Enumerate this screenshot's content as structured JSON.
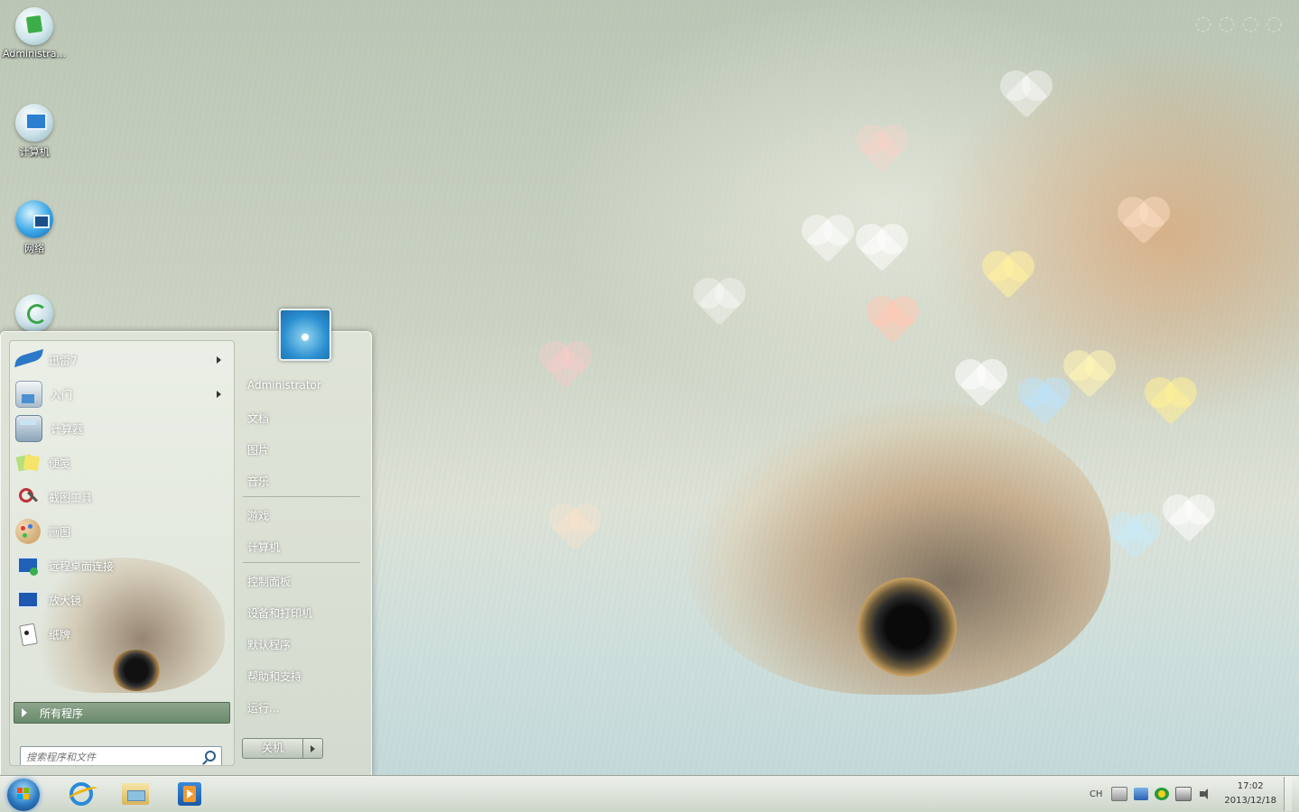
{
  "desktop": {
    "icons": [
      {
        "label": "Administra...",
        "icon": "user-folder-icon"
      },
      {
        "label": "计算机",
        "icon": "computer-icon"
      },
      {
        "label": "网络",
        "icon": "network-icon"
      },
      {
        "label": "",
        "icon": "recycle-bin-icon"
      }
    ]
  },
  "start_menu": {
    "programs": [
      {
        "label": "迅雷7",
        "icon": "xunlei-bird-icon",
        "has_submenu": true
      },
      {
        "label": "入门",
        "icon": "getting-started-icon",
        "has_submenu": true
      },
      {
        "label": "计算器",
        "icon": "calculator-icon",
        "has_submenu": false
      },
      {
        "label": "便笺",
        "icon": "sticky-notes-icon",
        "has_submenu": false
      },
      {
        "label": "截图工具",
        "icon": "snipping-tool-icon",
        "has_submenu": false
      },
      {
        "label": "画图",
        "icon": "paint-palette-icon",
        "has_submenu": false
      },
      {
        "label": "远程桌面连接",
        "icon": "remote-desktop-icon",
        "has_submenu": false
      },
      {
        "label": "放大镜",
        "icon": "magnifier-icon",
        "has_submenu": false
      },
      {
        "label": "纸牌",
        "icon": "solitaire-cards-icon",
        "has_submenu": false
      }
    ],
    "all_programs_label": "所有程序",
    "search_placeholder": "搜索程序和文件",
    "right_items": {
      "user": "Administrator",
      "documents": "文档",
      "pictures": "图片",
      "music": "音乐",
      "games": "游戏",
      "computer": "计算机",
      "control_panel": "控制面板",
      "devices": "设备和打印机",
      "default_programs": "默认程序",
      "help": "帮助和支持",
      "run": "运行..."
    },
    "shutdown_label": "关机"
  },
  "taskbar": {
    "apps": [
      "internet-explorer-icon",
      "windows-explorer-icon",
      "media-player-icon"
    ],
    "language": "CH",
    "clock_time": "17:02",
    "clock_date": "2013/12/18",
    "colors": {
      "start_orb": "#2c7ac0"
    }
  }
}
